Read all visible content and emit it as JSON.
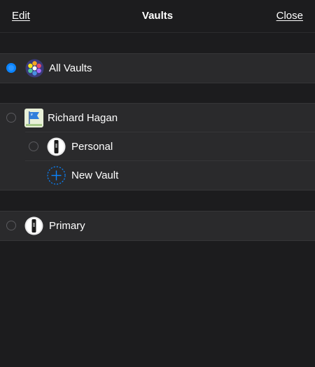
{
  "header": {
    "edit_label": "Edit",
    "title": "Vaults",
    "close_label": "Close"
  },
  "vaults": {
    "all_vaults": {
      "label": "All Vaults",
      "selected": true,
      "icon": "all-vaults-icon"
    },
    "account": {
      "name": "Richard Hagan",
      "icon": "account-flag-icon",
      "vaults": [
        {
          "label": "Personal",
          "icon": "vault-keyhole-icon"
        }
      ],
      "new_vault_label": "New Vault"
    },
    "primary": {
      "label": "Primary",
      "icon": "vault-keyhole-icon"
    }
  },
  "colors": {
    "background": "#1c1c1e",
    "row_background": "#2a2a2c",
    "accent": "#0a84ff"
  }
}
